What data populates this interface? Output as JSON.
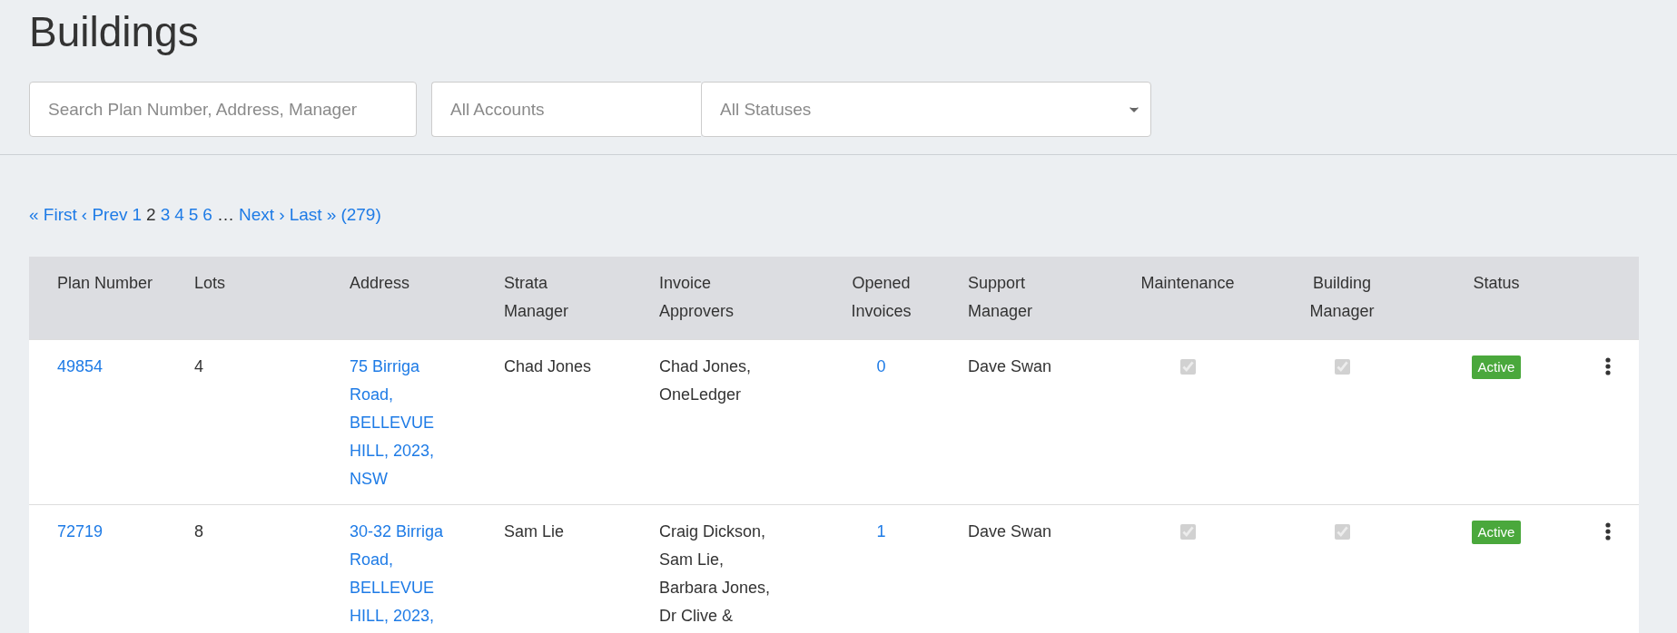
{
  "title": "Buildings",
  "filters": {
    "search": {
      "placeholder": "Search Plan Number, Address, Manager"
    },
    "accounts": {
      "placeholder": "All Accounts"
    },
    "statuses": {
      "placeholder": "All Statuses"
    }
  },
  "pagination": [
    {
      "label": "« First",
      "kind": "link",
      "selected": false
    },
    {
      "label": "‹ Prev",
      "kind": "link",
      "selected": false
    },
    {
      "label": "1",
      "kind": "link",
      "selected": false
    },
    {
      "label": "2",
      "kind": "link",
      "selected": true
    },
    {
      "label": "3",
      "kind": "link",
      "selected": false
    },
    {
      "label": "4",
      "kind": "link",
      "selected": false
    },
    {
      "label": "5",
      "kind": "link",
      "selected": false
    },
    {
      "label": "6",
      "kind": "link",
      "selected": false
    },
    {
      "label": "…",
      "kind": "ellipsis"
    },
    {
      "label": "Next ›",
      "kind": "link",
      "selected": false
    },
    {
      "label": "Last »",
      "kind": "link",
      "selected": false
    },
    {
      "label": "(279)",
      "kind": "link",
      "selected": false
    }
  ],
  "table": {
    "columns": [
      "Plan Number",
      "Lots",
      "Address",
      "Strata Manager",
      "Invoice Approvers",
      "Opened Invoices",
      "Support Manager",
      "Maintenance",
      "Building Manager",
      "Status"
    ],
    "rows": [
      {
        "plan_number": "49854",
        "lots": "4",
        "address": "75 Birriga Road, BELLEVUE HILL, 2023, NSW",
        "strata_manager": "Chad Jones",
        "invoice_approvers": "Chad Jones, OneLedger",
        "opened_invoices": "0",
        "support_manager": "Dave Swan",
        "maintenance": {
          "checked": true
        },
        "building_manager": {
          "checked": true
        },
        "status": {
          "label": "Active",
          "color": "#4aa83c"
        }
      },
      {
        "plan_number": "72719",
        "lots": "8",
        "address": "30-32 Birriga Road, BELLEVUE HILL, 2023,",
        "strata_manager": "Sam Lie",
        "invoice_approvers": "Craig Dickson, Sam Lie, Barbara Jones, Dr Clive &",
        "opened_invoices": "1",
        "support_manager": "Dave Swan",
        "maintenance": {
          "checked": true
        },
        "building_manager": {
          "checked": true
        },
        "status": {
          "label": "Active",
          "color": "#4aa83c"
        }
      }
    ]
  }
}
